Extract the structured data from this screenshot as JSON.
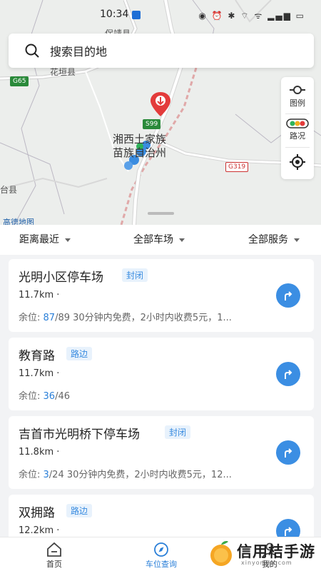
{
  "status_bar": {
    "time": "10:34",
    "icons_text": "◉ ⏰ ✱ ⌔ ᯤ ▂▄▆ ▭"
  },
  "search": {
    "placeholder": "搜索目的地"
  },
  "map": {
    "labels": {
      "town_top": "保靖县",
      "huayuan": "花垣县",
      "county_left": "台县",
      "city_line1": "湘西土家族",
      "city_line2": "苗族自治州",
      "roads": {
        "g65": "G65",
        "s99": "S99",
        "g319": "G319"
      }
    },
    "side_buttons": {
      "legend": "图例",
      "traffic": "路况"
    },
    "logo": "高德地图"
  },
  "filters": {
    "distance": "距离最近",
    "lots": "全部车场",
    "services": "全部服务"
  },
  "parking_lots": [
    {
      "name": "光明小区停车场",
      "tag": "封闭",
      "distance": "11.7km ·",
      "remaining_label": "余位: ",
      "available": "87",
      "total": "/89",
      "info": "   30分钟内免费，2小时内收费5元，1..."
    },
    {
      "name": "教育路",
      "tag": "路边",
      "distance": "11.7km ·",
      "remaining_label": "余位: ",
      "available": "36",
      "total": "/46",
      "info": ""
    },
    {
      "name": "吉首市光明桥下停车场",
      "tag": "封闭",
      "distance": "11.8km ·",
      "remaining_label": "余位: ",
      "available": "3",
      "total": "/24",
      "info": "   30分钟内免费，2小时内收费5元，12..."
    },
    {
      "name": "双拥路",
      "tag": "路边",
      "distance": "12.2km ·",
      "remaining_label": "",
      "available": "",
      "total": "",
      "info": ""
    }
  ],
  "bottom_nav": {
    "home": "首页",
    "spot_query": "车位查询",
    "mine": "我的"
  },
  "watermark": {
    "text": "信用桔手游",
    "url": "xinyongju.com"
  },
  "colors": {
    "accent": "#2a7fd8",
    "nav_button": "#3b8ee3",
    "tag_bg": "#e8f2fc"
  }
}
